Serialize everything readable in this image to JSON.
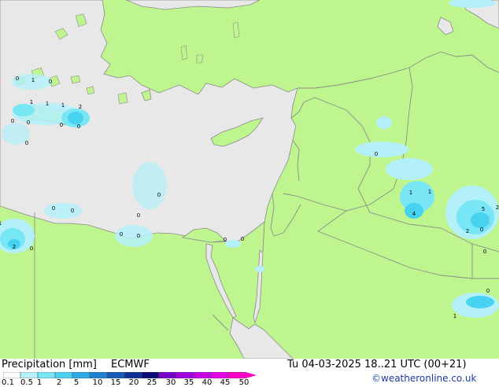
{
  "map": {
    "colors": {
      "land": "#bff58f",
      "sea": "#e8e8e8",
      "border": "#8c8c8c",
      "coast": "#8a8a8a"
    },
    "precip_labels": [
      "0",
      "1",
      "0",
      "1",
      "1",
      "1",
      "2",
      "0",
      "0",
      "0",
      "0",
      "0",
      "0",
      "0",
      "0",
      "0",
      "0",
      "0",
      "0",
      "2",
      "1",
      "0",
      "0",
      "0",
      "1",
      "1",
      "4",
      "5",
      "0",
      "2",
      "2",
      "0",
      "0",
      "1"
    ]
  },
  "footer": {
    "title": "Precipitation [mm]",
    "model": "ECMWF",
    "datetime": "Tu 04-03-2025 18..21 UTC (00+21)",
    "credit": "©weatheronline.co.uk",
    "scale_labels": [
      "0.1",
      "0.5",
      "1",
      "2",
      "5",
      "10",
      "15",
      "20",
      "25",
      "30",
      "35",
      "40",
      "45",
      "50"
    ],
    "scale_colors": [
      "#fefefe",
      "#b4f0fa",
      "#78e6f5",
      "#46d2f0",
      "#2daae6",
      "#1e82d2",
      "#145ab9",
      "#0a3296",
      "#0a0a78",
      "#7800c8",
      "#a000dc",
      "#c800e6",
      "#e600e6",
      "#ff00c8"
    ]
  }
}
